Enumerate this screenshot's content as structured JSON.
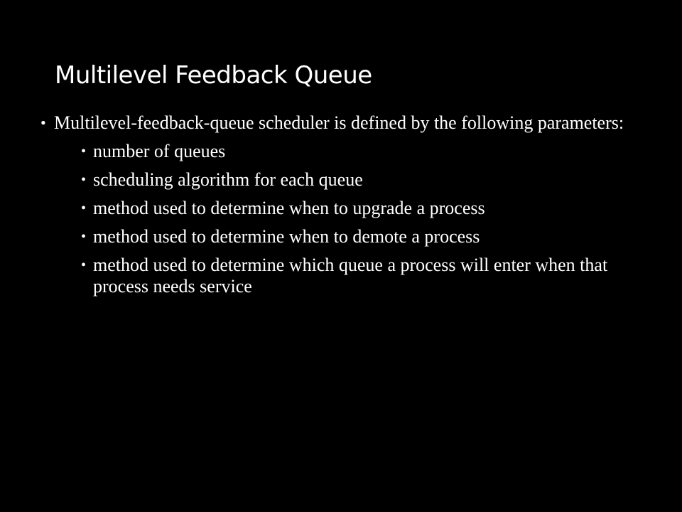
{
  "slide": {
    "title": "Multilevel Feedback Queue",
    "bullets": [
      {
        "text": "Multilevel-feedback-queue scheduler is defined by the following parameters:",
        "sub_bullets": [
          "number of queues",
          "scheduling algorithm for each queue",
          "method used to determine when to upgrade a process",
          "method used to determine when to demote a process",
          "method used to determine which queue a process will enter when that process needs service"
        ]
      }
    ]
  },
  "colors": {
    "background": "#000000",
    "text": "#ffffff"
  }
}
